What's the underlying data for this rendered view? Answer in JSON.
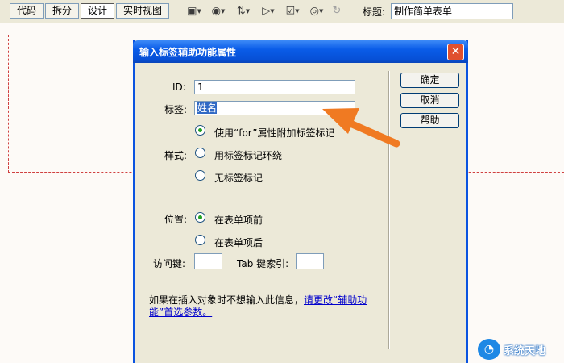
{
  "toolbar": {
    "view_code": "代码",
    "view_split": "拆分",
    "view_design": "设计",
    "view_live": "实时视图",
    "title_label": "标题:",
    "title_value": "制作简单表单"
  },
  "dialog": {
    "title": "输入标签辅助功能属性",
    "close": "✕",
    "id_label": "ID:",
    "id_value": "1",
    "label_label": "标签:",
    "label_value": "姓名",
    "style_label": "样式:",
    "style_options": [
      "使用“for”属性附加标签标记",
      "用标签标记环绕",
      "无标签标记"
    ],
    "style_selected": 0,
    "position_label": "位置:",
    "position_options": [
      "在表单项前",
      "在表单项后"
    ],
    "position_selected": 0,
    "access_key_label": "访问键:",
    "access_key_value": "",
    "tab_index_label": "Tab 键索引:",
    "tab_index_value": "",
    "info_text": "如果在插入对象时不想输入此信息，",
    "info_link": "请更改“辅助功能”首选参数。",
    "ok_button": "确定",
    "cancel_button": "取消",
    "help_button": "帮助"
  },
  "watermark": {
    "text": "系统天地"
  },
  "colors": {
    "titlebar": "#0a5ce8",
    "dialog_bg": "#ece9d8",
    "arrow": "#f07a22",
    "selection": "#316ac5",
    "link": "#0000cc"
  }
}
